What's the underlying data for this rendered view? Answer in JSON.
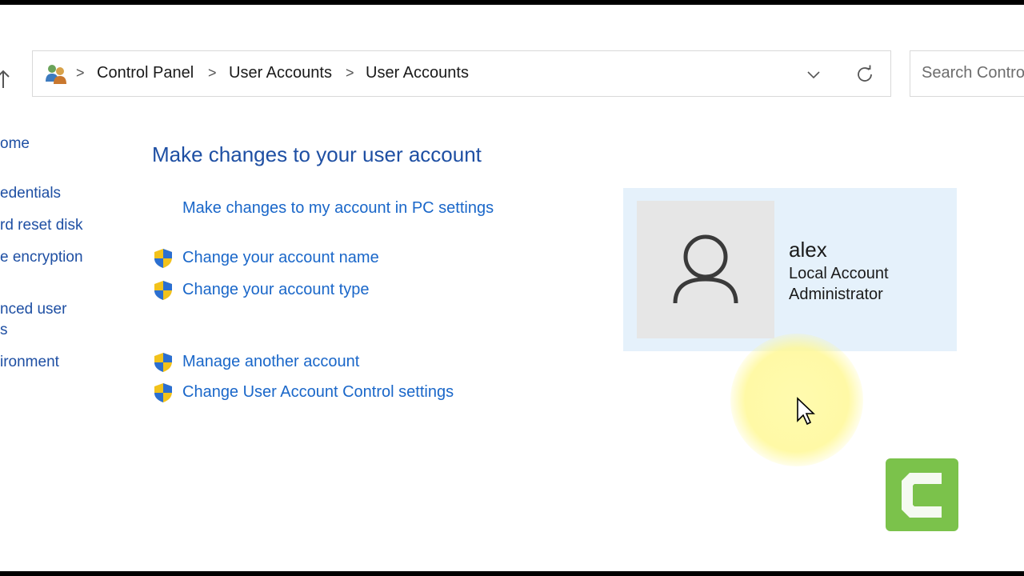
{
  "breadcrumb": {
    "items": [
      "Control Panel",
      "User Accounts",
      "User Accounts"
    ],
    "separator": ">"
  },
  "search": {
    "placeholder": "Search Control Panel"
  },
  "left_nav": {
    "items": [
      "ome",
      "edentials",
      "rd reset disk",
      "e encryption",
      "nced user",
      "s",
      "ironment"
    ]
  },
  "main": {
    "title": "Make changes to your user account",
    "pc_settings_link": "Make changes to my account in PC settings",
    "tasks": [
      "Change your account name",
      "Change your account type",
      "Manage another account",
      "Change User Account Control settings"
    ]
  },
  "account": {
    "name": "alex",
    "type": "Local Account",
    "role": "Administrator"
  },
  "colors": {
    "link": "#1a67c9",
    "heading": "#1e4fa3",
    "tile": "#e5f1fb",
    "logo": "#7bc24b"
  }
}
